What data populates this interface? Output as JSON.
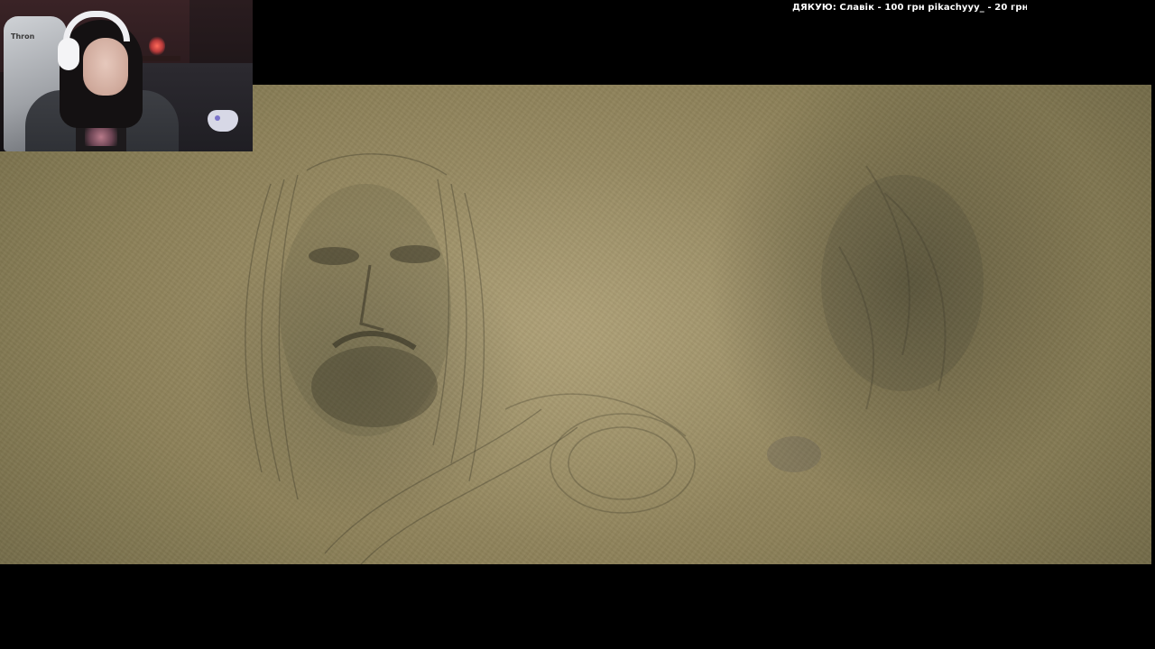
{
  "stream": {
    "ticker": {
      "text": "ДЯКУЮ:  Славік  -  100 грн  pikachyyy_  -  20 грн  Д"
    }
  },
  "webcam": {
    "chair_brand": "Thron"
  },
  "game": {
    "scene": "parchment-sketch-cutscene"
  }
}
